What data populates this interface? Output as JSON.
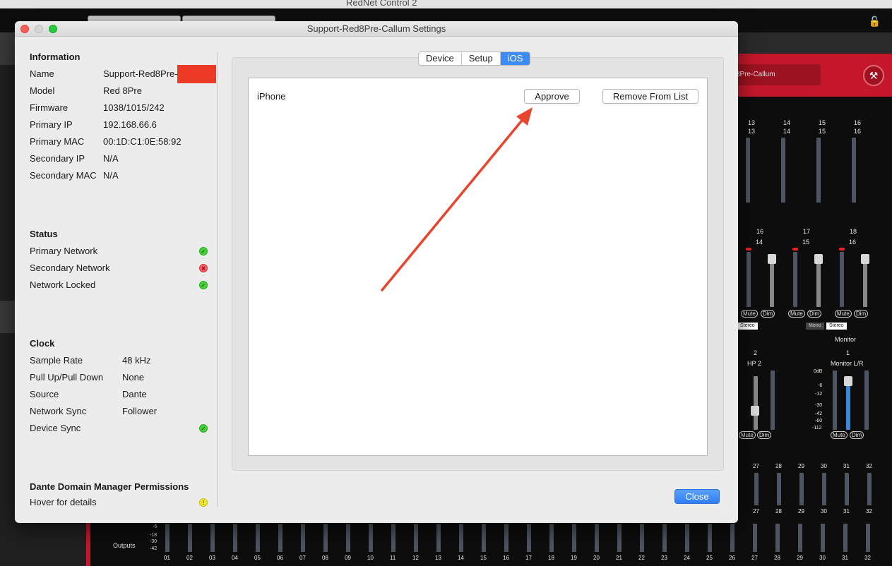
{
  "background_app": {
    "title": "RedNet Control 2",
    "device_label": "8Pre-Callum",
    "input_channels": [
      "13",
      "14",
      "15",
      "16"
    ],
    "input_channels_sub": [
      "13",
      "14",
      "15",
      "16"
    ],
    "mix_channels": [
      "16",
      "17",
      "18"
    ],
    "mix_channels_sub": [
      "14",
      "15",
      "16"
    ],
    "mute_label": "Mute",
    "dim_label": "Dim",
    "mono_label": "Mono",
    "stereo_label": "Stereo",
    "hp_number": "2",
    "hp_label": "HP 2",
    "monitor_header": "Monitor",
    "monitor_number": "1",
    "monitor_label": "Monitor L/R",
    "monitor_scale": [
      "0dB",
      "-6",
      "-12",
      "-30",
      "-42",
      "-60",
      "-112"
    ],
    "upper_right_channels": [
      "27",
      "28",
      "29",
      "30",
      "31",
      "32"
    ],
    "outputs_label": "Outputs",
    "outputs_scale": [
      "-6",
      "-18",
      "-30",
      "-42"
    ],
    "output_channels": [
      "01",
      "02",
      "03",
      "04",
      "05",
      "06",
      "07",
      "08",
      "09",
      "10",
      "11",
      "12",
      "13",
      "14",
      "15",
      "16",
      "17",
      "18",
      "19",
      "20",
      "21",
      "22",
      "23",
      "24",
      "25",
      "26",
      "27",
      "28",
      "29",
      "30",
      "31",
      "32"
    ]
  },
  "dialog": {
    "title": "Support-Red8Pre-Callum Settings",
    "close_label": "Close"
  },
  "information": {
    "heading": "Information",
    "rows": [
      {
        "label": "Name",
        "value": "Support-Red8Pre-"
      },
      {
        "label": "Model",
        "value": "Red 8Pre"
      },
      {
        "label": "Firmware",
        "value": "1038/1015/242"
      },
      {
        "label": "Primary IP",
        "value": "192.168.66.6"
      },
      {
        "label": "Primary MAC",
        "value": "00:1D:C1:0E:58:92"
      },
      {
        "label": "Secondary IP",
        "value": "N/A"
      },
      {
        "label": "Secondary MAC",
        "value": "N/A"
      }
    ]
  },
  "status": {
    "heading": "Status",
    "rows": [
      {
        "label": "Primary Network",
        "state": "ok",
        "color": "#44d638"
      },
      {
        "label": "Secondary Network",
        "state": "error",
        "color": "#ff5c66"
      },
      {
        "label": "Network Locked",
        "state": "ok",
        "color": "#44d638"
      }
    ]
  },
  "clock": {
    "heading": "Clock",
    "rows": [
      {
        "label": "Sample Rate",
        "value": "48 kHz"
      },
      {
        "label": "Pull Up/Pull Down",
        "value": "None"
      },
      {
        "label": "Source",
        "value": "Dante"
      },
      {
        "label": "Network Sync",
        "value": "Follower"
      },
      {
        "label": "Device Sync",
        "value": "",
        "state": "ok"
      }
    ]
  },
  "ddm": {
    "heading": "Dante Domain Manager Permissions",
    "hover_label": "Hover for details",
    "state": "warning",
    "color": "#f4ea2a"
  },
  "tabs": [
    {
      "label": "Device",
      "active": false
    },
    {
      "label": "Setup",
      "active": false
    },
    {
      "label": "iOS",
      "active": true
    }
  ],
  "ios": {
    "device_name": "iPhone",
    "approve_label": "Approve",
    "remove_label": "Remove From List"
  },
  "icons": {
    "ok": "checkmark-icon",
    "error": "x-icon",
    "warning": "exclamation-icon",
    "wrench": "wrench-icon",
    "lock": "lock-icon"
  },
  "colors": {
    "accent": "#3c8cf8",
    "app_red": "#c4172c",
    "annotation_arrow": "#e8442e",
    "redaction": "#ec3a26"
  }
}
